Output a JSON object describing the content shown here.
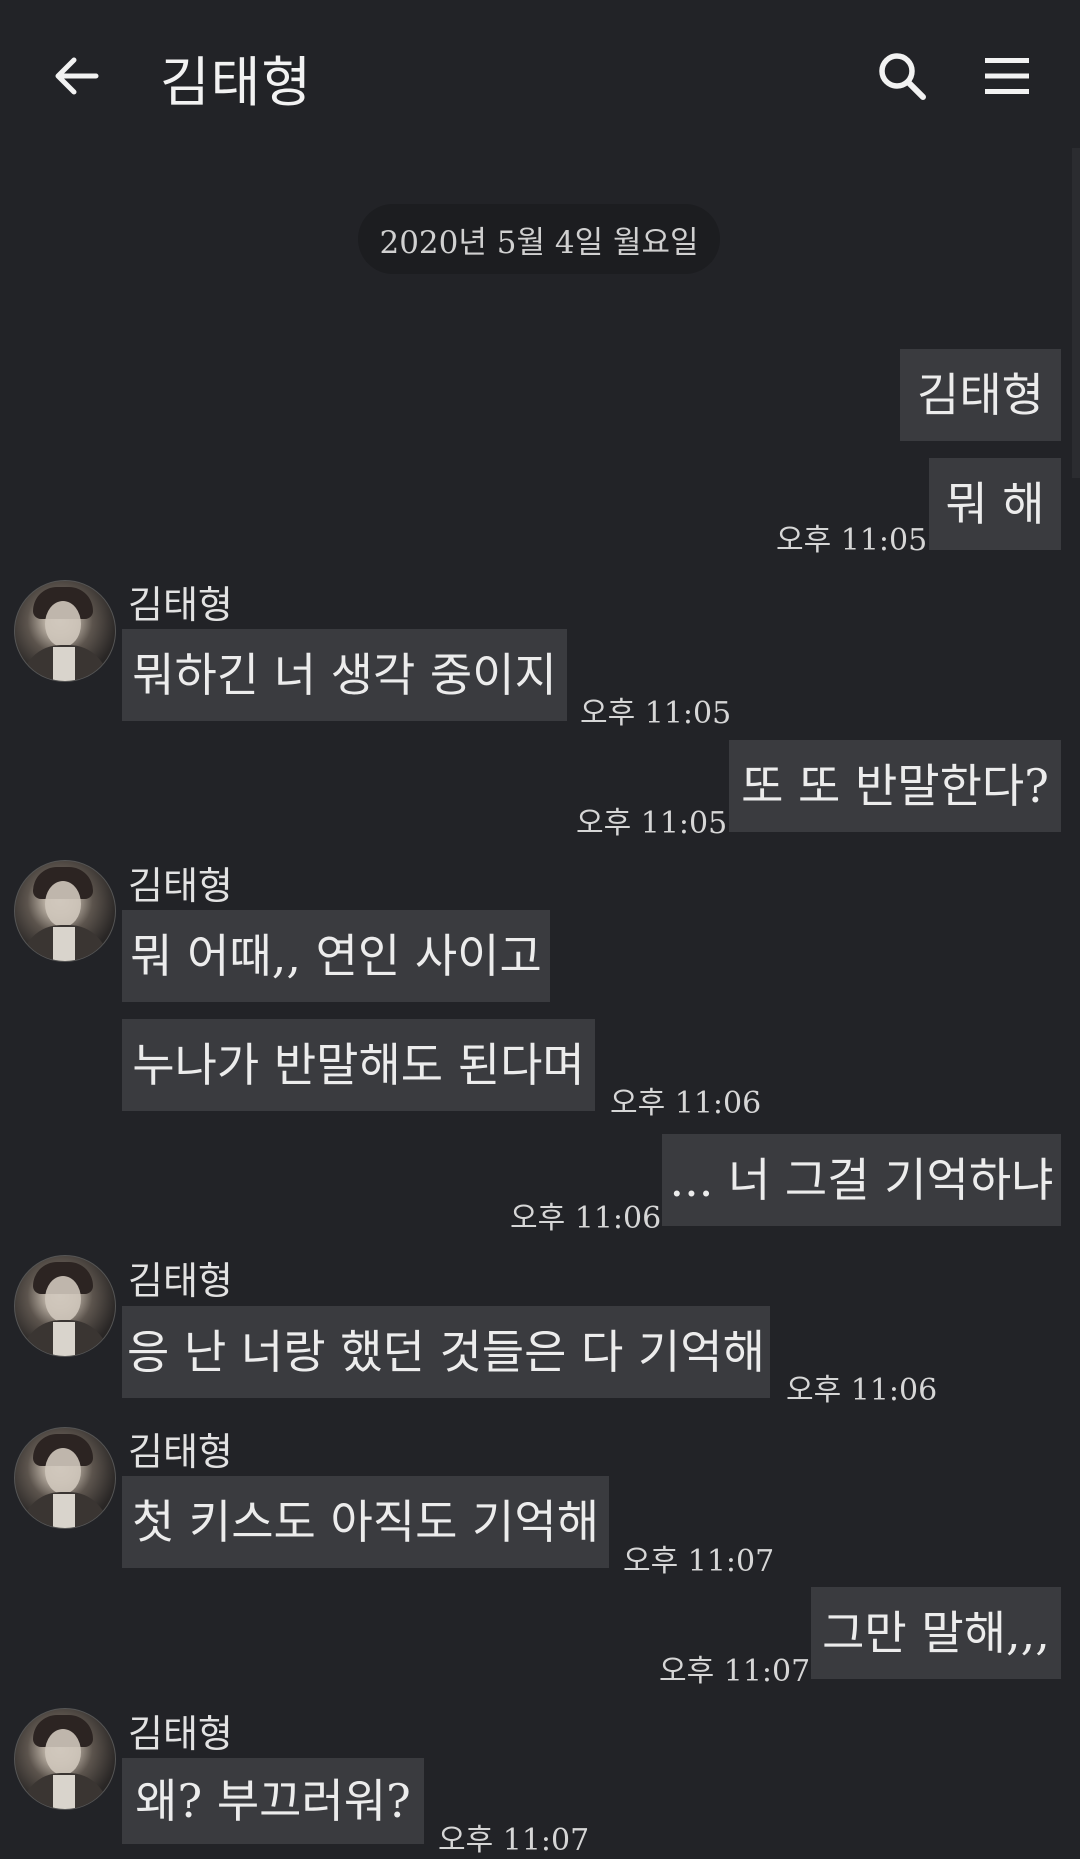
{
  "header": {
    "title": "김태형"
  },
  "date_divider": "2020년 5월 4일 월요일",
  "messages": {
    "m1": {
      "text": "김태형"
    },
    "m2": {
      "text": "뭐 해",
      "time": "오후 11:05"
    },
    "m3": {
      "sender": "김태형",
      "text": "뭐하긴 너 생각 중이지",
      "time": "오후 11:05"
    },
    "m4": {
      "text": "또 또 반말한다?",
      "time": "오후 11:05"
    },
    "m5": {
      "sender": "김태형",
      "text": "뭐 어때,, 연인 사이고"
    },
    "m6": {
      "text": "누나가 반말해도 된다며",
      "time": "오후 11:06"
    },
    "m7": {
      "text": "... 너 그걸 기억하냐",
      "time": "오후 11:06"
    },
    "m8": {
      "sender": "김태형",
      "text": "응 난 너랑 했던 것들은 다 기억해",
      "time": "오후 11:06"
    },
    "m9": {
      "sender": "김태형",
      "text": "첫 키스도 아직도 기억해",
      "time": "오후 11:07"
    },
    "m10": {
      "text": "그만 말해,,,",
      "time": "오후 11:07"
    },
    "m11": {
      "sender": "김태형",
      "text": "왜? 부끄러워?",
      "time": "오후 11:07"
    }
  },
  "icons": {
    "back": "arrow-left-icon",
    "search": "search-icon",
    "menu": "hamburger-menu-icon"
  },
  "colors": {
    "background": "#222327",
    "bubble": "#3a3b3f",
    "date_pill": "#1c1d20",
    "text": "#ececec"
  }
}
